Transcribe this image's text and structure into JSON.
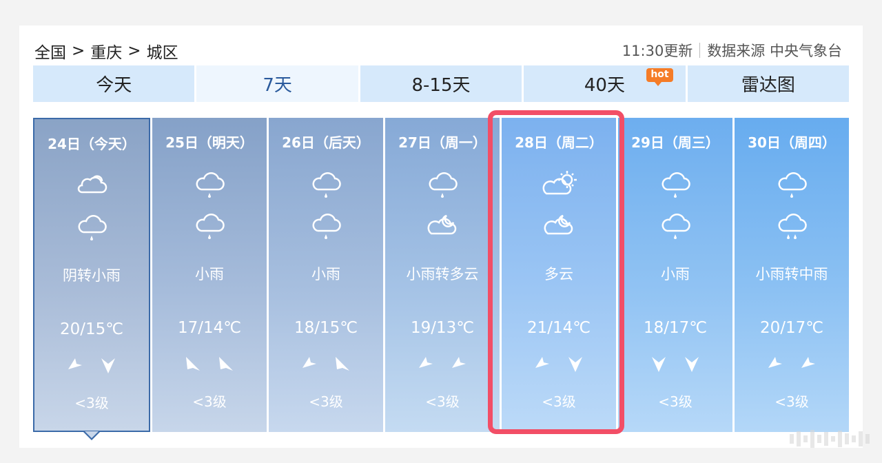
{
  "breadcrumb": {
    "country": "全国",
    "sep1": ">",
    "city": "重庆",
    "sep2": ">",
    "district": "城区"
  },
  "meta": {
    "update": "11:30更新",
    "source": "数据来源 中央气象台"
  },
  "tabs": [
    {
      "label": "今天"
    },
    {
      "label": "7天"
    },
    {
      "label": "8-15天"
    },
    {
      "label": "40天",
      "badge": "hot"
    },
    {
      "label": "雷达图"
    }
  ],
  "days": [
    {
      "date": "24日（今天）",
      "icon_day": "cloudy-icon",
      "icon_night": "rain-icon",
      "desc": "阴转小雨",
      "temp": "20/15℃",
      "wind_level": "<3级"
    },
    {
      "date": "25日（明天）",
      "icon_day": "rain-icon",
      "icon_night": "rain-icon",
      "desc": "小雨",
      "temp": "17/14℃",
      "wind_level": "<3级"
    },
    {
      "date": "26日（后天）",
      "icon_day": "rain-icon",
      "icon_night": "rain-icon",
      "desc": "小雨",
      "temp": "18/15℃",
      "wind_level": "<3级"
    },
    {
      "date": "27日（周一）",
      "icon_day": "rain-icon",
      "icon_night": "partly-cloudy-night-icon",
      "desc": "小雨转多云",
      "temp": "19/13℃",
      "wind_level": "<3级"
    },
    {
      "date": "28日（周二）",
      "icon_day": "partly-cloudy-day-icon",
      "icon_night": "partly-cloudy-night-icon",
      "desc": "多云",
      "temp": "21/14℃",
      "wind_level": "<3级"
    },
    {
      "date": "29日（周三）",
      "icon_day": "rain-icon",
      "icon_night": "rain-icon",
      "desc": "小雨",
      "temp": "18/17℃",
      "wind_level": "<3级"
    },
    {
      "date": "30日（周四）",
      "icon_day": "rain-icon",
      "icon_night": "moderate-rain-icon",
      "desc": "小雨转中雨",
      "temp": "20/17℃",
      "wind_level": "<3级"
    }
  ],
  "colors": {
    "highlight": "#f24e66",
    "tab_bg": "#d6e9fb",
    "hot_badge": "#f57c27"
  }
}
